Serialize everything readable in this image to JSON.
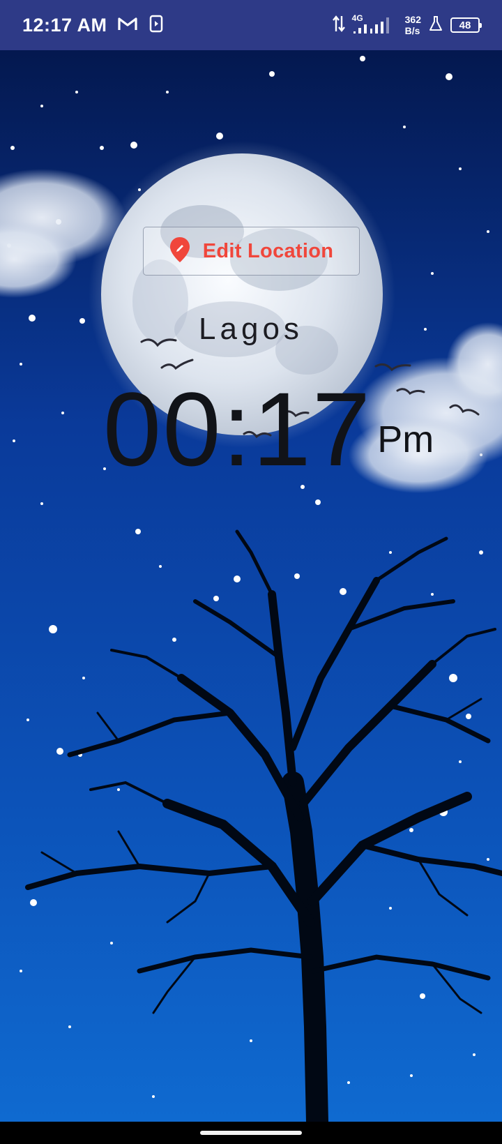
{
  "status_bar": {
    "time": "12:17 AM",
    "network_type": "4G",
    "speed_value": "362",
    "speed_unit": "B/s",
    "battery_level": "48",
    "background_color": "#2e3a87",
    "icons": [
      "gmail-icon",
      "media-play-icon",
      "data-transfer-icon",
      "signal-icon",
      "lab-flask-icon",
      "battery-icon"
    ]
  },
  "main": {
    "edit_location_label": "Edit Location",
    "edit_location_icon": "location-pin-icon",
    "accent_color": "#f0463b",
    "city": "Lagos",
    "time": "00:17",
    "ampm": "Pm"
  },
  "wallpaper": {
    "description_icons": [
      "moon-image",
      "tree-silhouette-image",
      "clouds-image",
      "birds-image",
      "stars-image"
    ]
  }
}
